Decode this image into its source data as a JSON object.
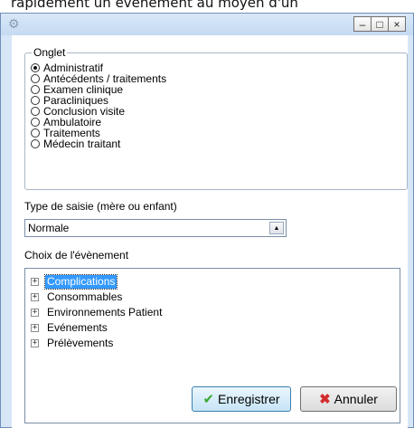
{
  "background_text": "rapidement un événement au moyen d'un",
  "window": {
    "icon": "gear-icon",
    "controls": {
      "minimize": "–",
      "maximize": "□",
      "close": "×"
    }
  },
  "onglet": {
    "title": "Onglet",
    "options": [
      {
        "label": "Administratif",
        "selected": true
      },
      {
        "label": "Antécédents / traitements",
        "selected": false
      },
      {
        "label": "Examen clinique",
        "selected": false
      },
      {
        "label": "Paracliniques",
        "selected": false
      },
      {
        "label": "Conclusion visite",
        "selected": false
      },
      {
        "label": "Ambulatoire",
        "selected": false
      },
      {
        "label": "Traitements",
        "selected": false
      },
      {
        "label": "Médecin traitant",
        "selected": false
      }
    ]
  },
  "type_saisie": {
    "label": "Type de saisie (mère ou enfant)",
    "value": "Normale"
  },
  "choix": {
    "label": "Choix de l'évènement",
    "items": [
      {
        "label": "Complications",
        "selected": true
      },
      {
        "label": "Consommables",
        "selected": false
      },
      {
        "label": "Environnements Patient",
        "selected": false
      },
      {
        "label": "Evénements",
        "selected": false
      },
      {
        "label": "Prélèvements",
        "selected": false
      }
    ]
  },
  "buttons": {
    "save": "Enregistrer",
    "cancel": "Annuler"
  },
  "colors": {
    "selection": "#3399ff",
    "window_frame": "#d6e6f7",
    "save_icon": "#3aa832",
    "cancel_icon": "#d32c2c"
  }
}
